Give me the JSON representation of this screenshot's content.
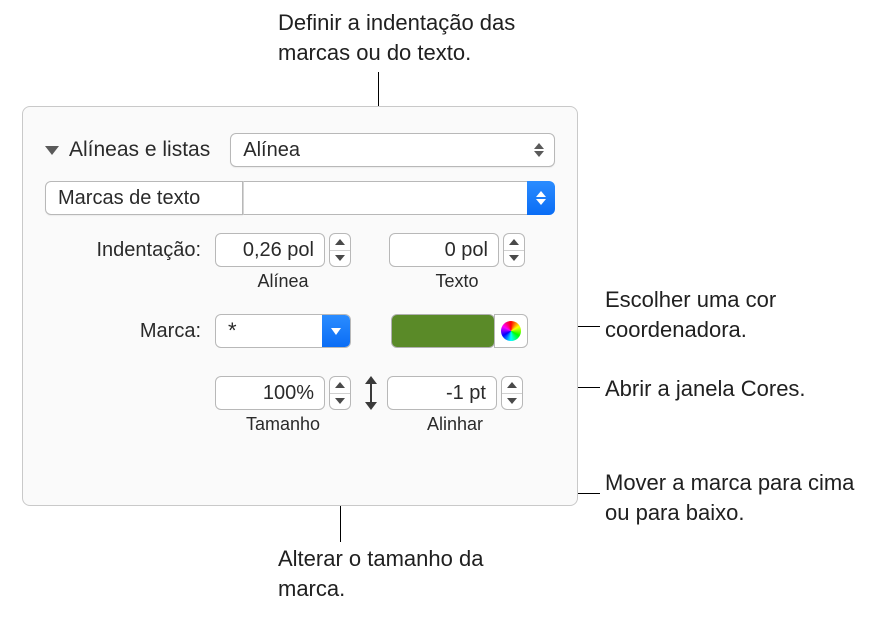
{
  "callouts": {
    "top": "Definir a indentação das marcas ou do texto.",
    "color": "Escolher uma cor coordenadora.",
    "wheel": "Abrir a janela Cores.",
    "align": "Mover a marca para cima ou para baixo.",
    "size": "Alterar o tamanho da marca."
  },
  "panel": {
    "section_title": "Alíneas e listas",
    "style_popup": "Alínea",
    "type_popup": "Marcas de texto",
    "indent": {
      "label": "Indentação:",
      "bullet": {
        "value": "0,26 pol",
        "sublabel": "Alínea"
      },
      "text": {
        "value": "0 pol",
        "sublabel": "Texto"
      }
    },
    "marker": {
      "label": "Marca:",
      "symbol": "*",
      "color": "#5a8a28"
    },
    "size": {
      "value": "100%",
      "sublabel": "Tamanho"
    },
    "align": {
      "value": "-1 pt",
      "sublabel": "Alinhar"
    }
  }
}
